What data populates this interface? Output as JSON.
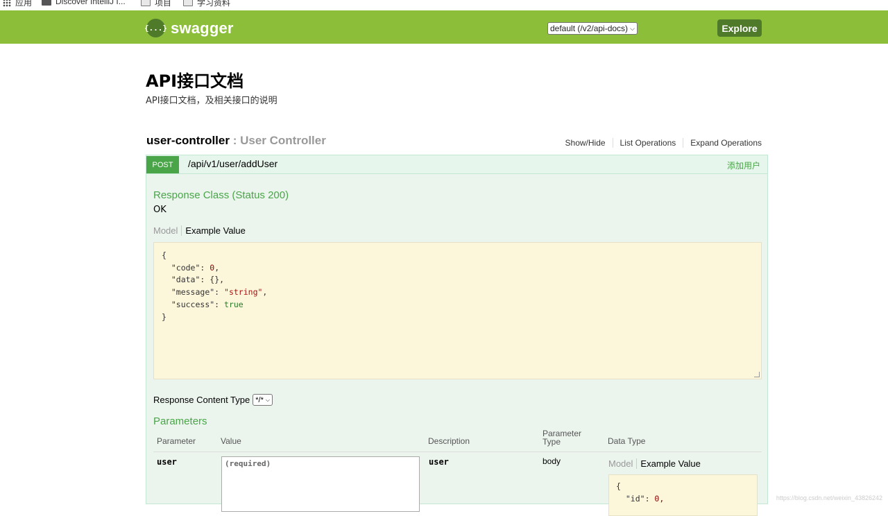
{
  "bookmarks": {
    "items": [
      {
        "label": "应用",
        "icon": "apps-grid-icon"
      },
      {
        "label": "Discover IntelliJ I...",
        "icon": "intellij-icon"
      },
      {
        "label": "项目",
        "icon": "folder-icon"
      },
      {
        "label": "学习资料",
        "icon": "folder-icon"
      }
    ]
  },
  "header": {
    "logo_glyph": "{...}",
    "logo_text": "swagger",
    "api_select_value": "default (/v2/api-docs)",
    "explore_label": "Explore",
    "bg_color": "#8cbe3a",
    "button_color": "#4e7a2a"
  },
  "info": {
    "title": "API接口文档",
    "description": "API接口文档，及相关接口的说明"
  },
  "resource": {
    "name": "user-controller",
    "separator": " : ",
    "description": "User Controller",
    "links": {
      "show_hide": "Show/Hide",
      "list_operations": "List Operations",
      "expand_operations": "Expand Operations"
    }
  },
  "operation": {
    "method": "POST",
    "path": "/api/v1/user/addUser",
    "summary": "添加用户",
    "method_color": "#49a547",
    "response_class_heading": "Response Class (Status 200)",
    "response_class_value": "OK",
    "model_tab": "Model",
    "example_tab": "Example Value",
    "example_json": {
      "open": "{",
      "code_key": "\"code\"",
      "code_val": "0",
      "data_key": "\"data\"",
      "data_val": "{}",
      "message_key": "\"message\"",
      "message_val": "\"string\"",
      "success_key": "\"success\"",
      "success_val": "true",
      "close": "}"
    },
    "response_content_type_label": "Response Content Type",
    "response_content_type_value": "*/*",
    "parameters_heading": "Parameters",
    "param_columns": {
      "parameter": "Parameter",
      "value": "Value",
      "description": "Description",
      "parameter_type": "Parameter Type",
      "data_type": "Data Type"
    },
    "params": [
      {
        "name": "user",
        "value_placeholder": "(required)",
        "description": "user",
        "param_type": "body",
        "model_tab": "Model",
        "example_tab": "Example Value",
        "example_open": "{",
        "example_id_key": "\"id\"",
        "example_id_val": "0,"
      }
    ]
  },
  "watermark": "https://blog.csdn.net/weixin_43826242"
}
